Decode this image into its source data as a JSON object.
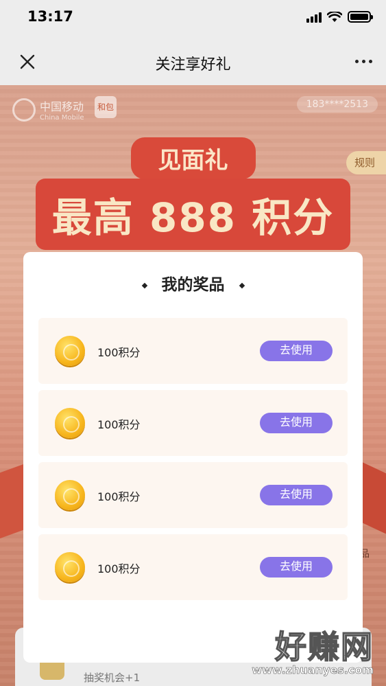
{
  "status_bar": {
    "time": "13:17"
  },
  "nav": {
    "title": "关注享好礼",
    "close_icon": "close-icon",
    "more_icon": "more-icon"
  },
  "background": {
    "brand_cn": "中国移动",
    "brand_en": "China Mobile",
    "hebao": "和包",
    "phone": "183****2513",
    "rules": "规则",
    "banner_sub": "见面礼",
    "banner_main": "最高 888 积分",
    "task_text": "抽奖机会+1",
    "right_label": "品"
  },
  "modal": {
    "title": "我的奖品",
    "prizes": [
      {
        "label": "100积分",
        "button": "去使用"
      },
      {
        "label": "100积分",
        "button": "去使用"
      },
      {
        "label": "100积分",
        "button": "去使用"
      },
      {
        "label": "100积分",
        "button": "去使用"
      }
    ]
  },
  "watermark": {
    "cn": "好赚网",
    "url": "www.zhuanyes.com"
  },
  "colors": {
    "button": "#8874e8",
    "prize_bg": "#fdf6f0",
    "overlay_bg": "#d9a08c"
  }
}
